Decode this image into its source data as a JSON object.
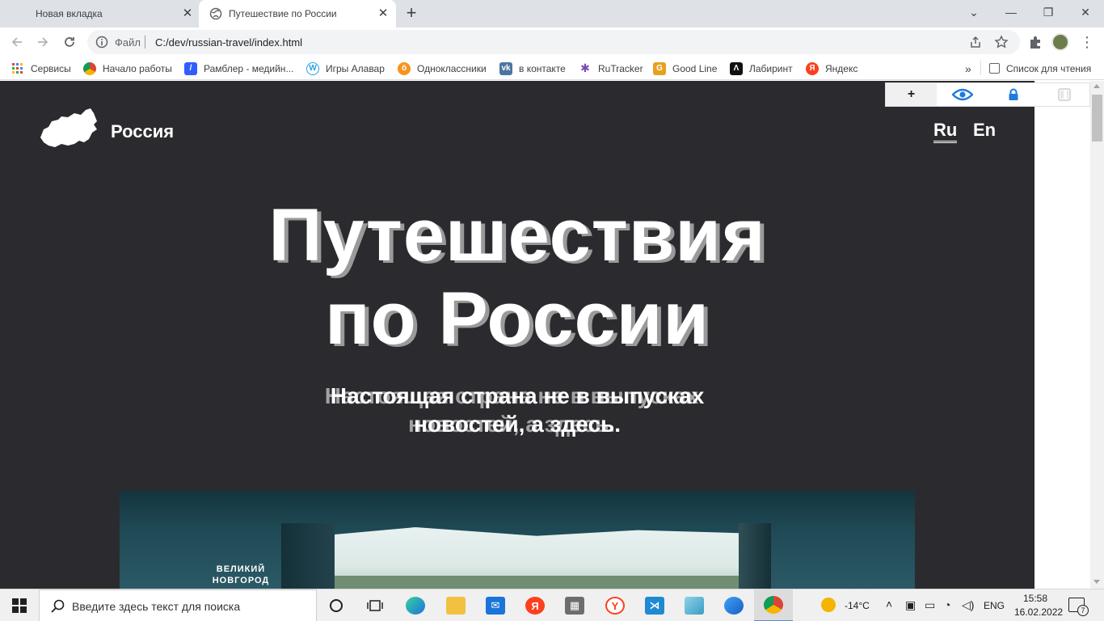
{
  "browser": {
    "tabs": [
      {
        "title": "Новая вкладка",
        "active": false
      },
      {
        "title": "Путешествие по России",
        "active": true
      }
    ],
    "address": {
      "scheme_label": "Файл",
      "url": "C:/dev/russian-travel/index.html"
    },
    "bookmarks": [
      {
        "label": "Сервисы",
        "icon": "apps-grid-icon",
        "color": "#e0472f"
      },
      {
        "label": "Начало работы",
        "icon": "chrome-icon",
        "color": "#4285f4"
      },
      {
        "label": "Рамблер - медийн...",
        "icon": "rambler-icon",
        "color": "#315efb"
      },
      {
        "label": "Игры Алавар",
        "icon": "alawar-icon",
        "color": "#2aa1e5"
      },
      {
        "label": "Одноклассники",
        "icon": "ok-icon",
        "color": "#f7931e"
      },
      {
        "label": "в контакте",
        "icon": "vk-icon",
        "color": "#4c75a3"
      },
      {
        "label": "RuTracker",
        "icon": "rutracker-icon",
        "color": "#7a4bb5"
      },
      {
        "label": "Good Line",
        "icon": "goodline-icon",
        "color": "#e8a020"
      },
      {
        "label": "Лабиринт",
        "icon": "labirint-icon",
        "color": "#111111"
      },
      {
        "label": "Яндекс",
        "icon": "yandex-icon",
        "color": "#fc3f1d"
      }
    ],
    "more_bookmarks": "»",
    "reading_list": "Список для чтения"
  },
  "page": {
    "brand": "Россия",
    "lang_ru": "Ru",
    "lang_en": "En",
    "title_line1": "Путешествия",
    "title_line2": "по России",
    "subtitle_line1": "Настоящая страна не в выпусках",
    "subtitle_line2": "новостей, а здесь.",
    "photo_caption_line1": "ВЕЛИКИЙ",
    "photo_caption_line2": "НОВГОРОД",
    "background_color": "#2b2b2f"
  },
  "extension_toolbar": {
    "buttons": [
      "+",
      "eye-icon",
      "lock-icon",
      "toggle-icon"
    ]
  },
  "taskbar": {
    "search_placeholder": "Введите здесь текст для поиска",
    "weather": "-14°C",
    "language": "ENG",
    "time": "15:58",
    "date": "16.02.2022",
    "notifications_count": "7"
  }
}
